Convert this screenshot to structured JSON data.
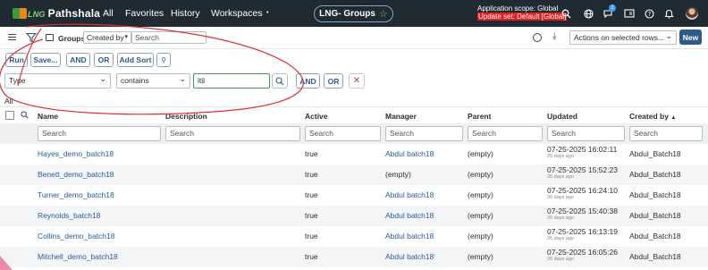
{
  "topnav": {
    "logo_text": "Pathshala",
    "logo_prefix": "LNG",
    "links": [
      "All",
      "Favorites",
      "History",
      "Workspaces"
    ],
    "title": "LNG- Groups",
    "scope_label": "Application scope: Global",
    "update_set": "Update set: Default [Global]",
    "notification_count": "1"
  },
  "toolbar": {
    "groups_label": "Groups",
    "search_by": "Created by",
    "search_placeholder": "Search",
    "actions_select": "Actions on selected rows...",
    "new_label": "New"
  },
  "filter": {
    "run": "Run",
    "save": "Save...",
    "and": "AND",
    "or": "OR",
    "add_sort": "Add Sort",
    "field": "Type",
    "operator": "contains",
    "value": "itil",
    "cond_and": "AND",
    "cond_or": "OR"
  },
  "breadcrumb": "All",
  "table": {
    "columns": [
      "Name",
      "Description",
      "Active",
      "Manager",
      "Parent",
      "Updated",
      "Created by"
    ],
    "sort_indicator": "▲",
    "search_placeholder": "Search",
    "rows": [
      {
        "name": "Hayes_demo_batch18",
        "description": "",
        "active": "true",
        "manager": "Abdul batch18",
        "manager_link": true,
        "parent": "(empty)",
        "updated": "07-25-2025 16:02:11",
        "ago": "26 days ago",
        "created_by": "Abdul_Batch18"
      },
      {
        "name": "Benett_demo_batch18",
        "description": "",
        "active": "true",
        "manager": "(empty)",
        "manager_link": false,
        "parent": "(empty)",
        "updated": "07-25-2025 15:52:23",
        "ago": "26 days ago",
        "created_by": "Abdul_Batch18"
      },
      {
        "name": "Turner_demo_batch18",
        "description": "",
        "active": "true",
        "manager": "Abdul batch18",
        "manager_link": true,
        "parent": "(empty)",
        "updated": "07-25-2025 16:24:10",
        "ago": "26 days ago",
        "created_by": "Abdul_Batch18"
      },
      {
        "name": "Reynolds_batch18",
        "description": "",
        "active": "true",
        "manager": "Abdul batch18",
        "manager_link": true,
        "parent": "(empty)",
        "updated": "07-25-2025 15:40:38",
        "ago": "26 days ago",
        "created_by": "Abdul_Batch18"
      },
      {
        "name": "Collins_demo_batch18",
        "description": "",
        "active": "true",
        "manager": "Abdul batch18",
        "manager_link": true,
        "parent": "(empty)",
        "updated": "07-25-2025 16:13:19",
        "ago": "26 days ago",
        "created_by": "Abdul_Batch18"
      },
      {
        "name": "Mitchell_demo_batch18",
        "description": "",
        "active": "true",
        "manager": "Abdul batch18",
        "manager_link": true,
        "parent": "(empty)",
        "updated": "07-25-2025 16:05:26",
        "ago": "26 days ago",
        "created_by": "Abdul_Batch18"
      }
    ]
  },
  "icons": [
    "menu-icon",
    "filter-icon",
    "list-icon",
    "gear-icon",
    "download-icon",
    "pin-icon",
    "search-icon",
    "close-icon",
    "star-icon",
    "globe-icon",
    "chat-icon",
    "help-icon",
    "bell-icon"
  ],
  "colors": {
    "nav_bg": "#1f2a33",
    "accent": "#2f5b8a",
    "link": "#2a5a9a",
    "annotation": "#e03030"
  }
}
